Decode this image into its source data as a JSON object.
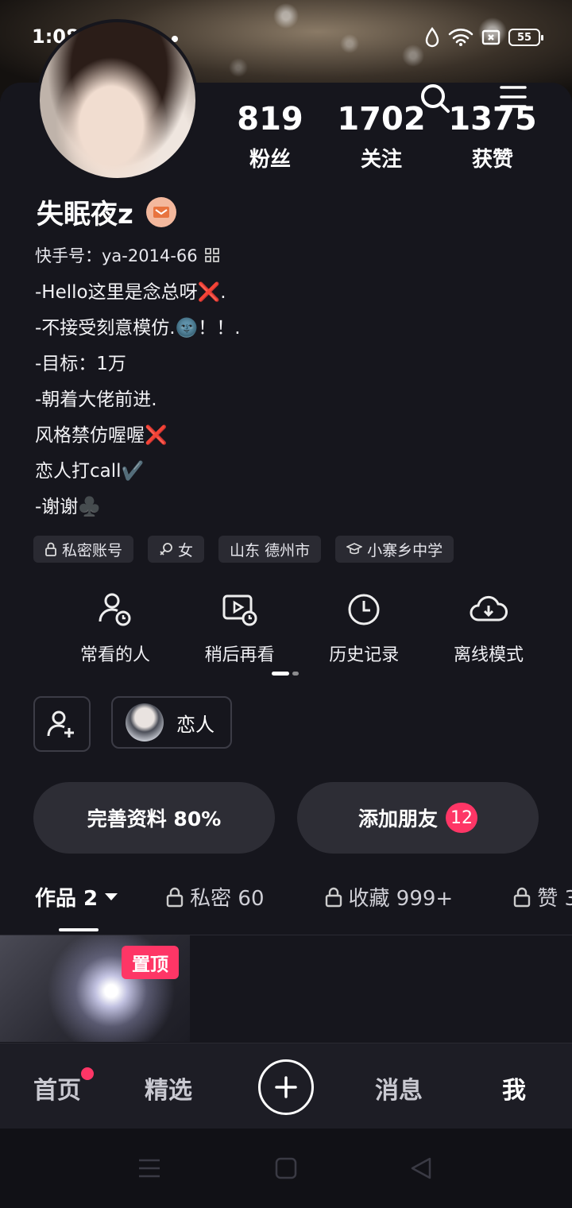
{
  "status_bar": {
    "time": "1:08",
    "battery": "55"
  },
  "profile": {
    "name": "失眠夜z",
    "uid_label": "快手号：ya-2014-66",
    "stats": [
      {
        "value": "819",
        "label": "粉丝"
      },
      {
        "value": "1702",
        "label": "关注"
      },
      {
        "value": "1375",
        "label": "获赞"
      }
    ],
    "bio": [
      "-Hello这里是念总呀❌.",
      "-不接受刻意模仿.🌚！！.",
      "-目标：1万",
      "-朝着大佬前进.",
      "风格禁仿喔喔❌",
      "恋人打call✔️",
      "-谢谢♣️"
    ],
    "tags": [
      {
        "icon": "lock-icon",
        "label": "私密账号"
      },
      {
        "icon": "gender-female-icon",
        "label": "女"
      },
      {
        "icon": "",
        "label": "山东 德州市"
      },
      {
        "icon": "graduation-cap-icon",
        "label": "小寨乡中学"
      }
    ]
  },
  "quick_actions": [
    {
      "icon": "people-clock-icon",
      "label": "常看的人"
    },
    {
      "icon": "play-later-icon",
      "label": "稍后再看"
    },
    {
      "icon": "clock-icon",
      "label": "历史记录"
    },
    {
      "icon": "cloud-download-icon",
      "label": "离线模式"
    }
  ],
  "lover_label": "恋人",
  "actions": {
    "complete_profile": "完善资料 80%",
    "add_friends": "添加朋友",
    "add_friends_count": "12"
  },
  "tabs": [
    {
      "label": "作品 2",
      "active": true
    },
    {
      "label": "私密 60",
      "locked": true
    },
    {
      "label": "收藏 999+",
      "locked": true
    },
    {
      "label": "赞 3",
      "locked": true
    }
  ],
  "video": {
    "pin_label": "置顶"
  },
  "bottom_nav": [
    "首页",
    "精选",
    "消息",
    "我"
  ],
  "colors": {
    "accent": "#fe3666",
    "background": "#16161d"
  }
}
